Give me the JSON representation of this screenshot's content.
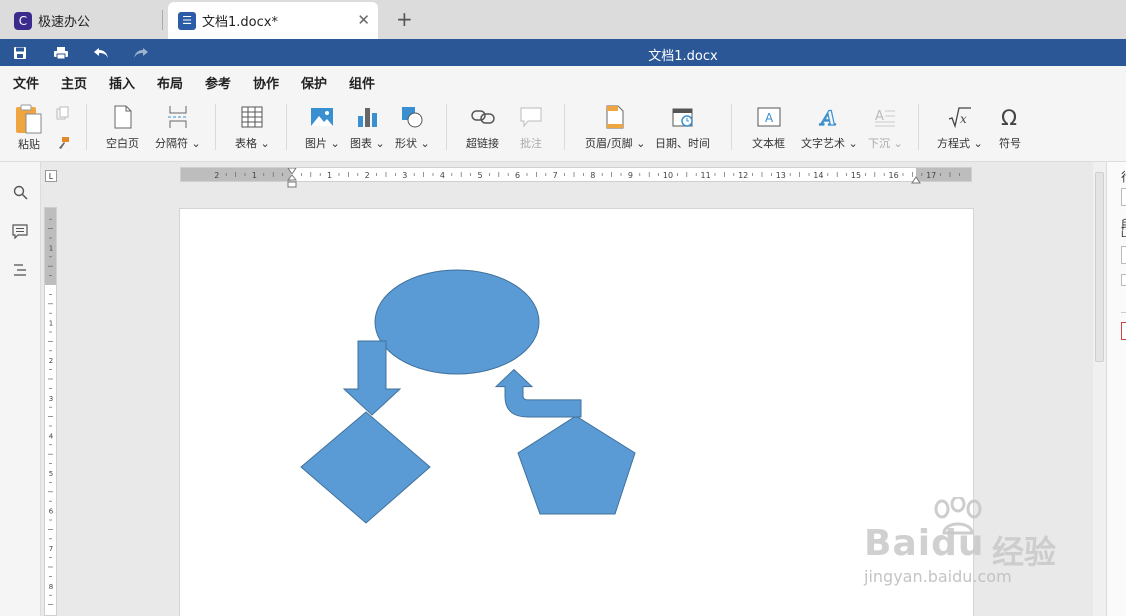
{
  "tabs": [
    {
      "label": "极速办公",
      "icon": "app-logo-icon"
    },
    {
      "label": "文档1.docx*",
      "icon": "document-icon"
    }
  ],
  "title_bar": {
    "document_title": "文档1.docx"
  },
  "menu": {
    "items": [
      "文件",
      "主页",
      "插入",
      "布局",
      "参考",
      "协作",
      "保护",
      "组件"
    ],
    "active": "插入"
  },
  "ribbon": {
    "paste": "粘贴",
    "blank_page": "空白页",
    "separator": "分隔符",
    "table": "表格",
    "picture": "图片",
    "chart": "图表",
    "shape": "形状",
    "hyperlink": "超链接",
    "comment": "批注",
    "header_footer": "页眉/页脚",
    "date_time": "日期、时间",
    "text_box": "文本框",
    "word_art": "文字艺术",
    "drop_cap": "下沉",
    "equation": "方程式",
    "symbol": "符号"
  },
  "ruler": {
    "corner": "L",
    "h_labels": [
      "2",
      "1",
      "1",
      "2",
      "3",
      "4",
      "5",
      "6",
      "7",
      "8",
      "9",
      "10",
      "11",
      "12",
      "13",
      "14",
      "15",
      "16",
      "17"
    ],
    "v_labels": [
      "1",
      "1",
      "2",
      "3",
      "4",
      "5",
      "6",
      "7",
      "8"
    ]
  },
  "right_panel": {
    "text_top": "行",
    "text_mid": "段",
    "text_low": "L"
  },
  "watermark": {
    "brand": "Baidu",
    "cn": "经验",
    "url": "jingyan.baidu.com"
  },
  "colors": {
    "accent": "#2b5797",
    "shape_fill": "#5b9bd5",
    "shape_stroke": "#41719c"
  }
}
